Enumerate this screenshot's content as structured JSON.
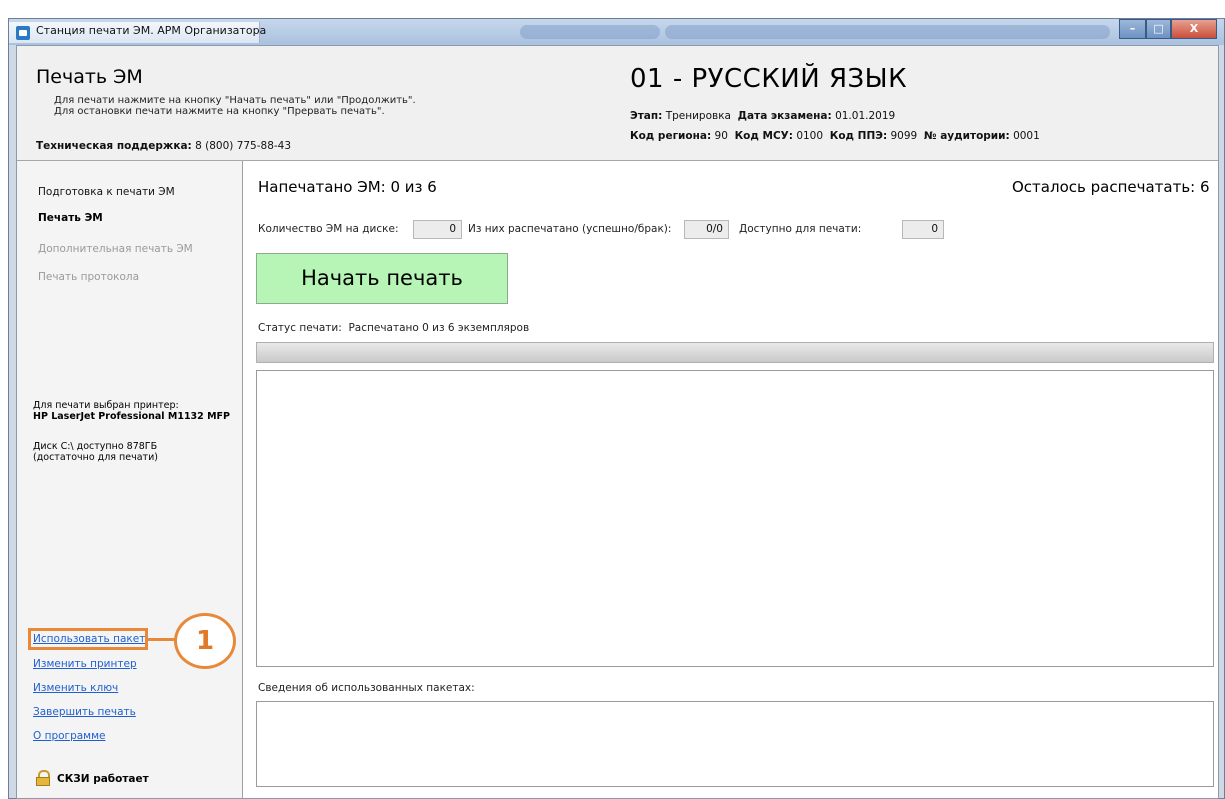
{
  "window": {
    "title": "Станция печати ЭМ. АРМ Организатора",
    "buttons": {
      "minimize": "–",
      "maximize": "□",
      "close": "X"
    }
  },
  "header": {
    "title": "Печать ЭМ",
    "hint_line1": "Для печати нажмите на кнопку \"Начать печать\" или \"Продолжить\".",
    "hint_line2": "Для остановки печати нажмите на кнопку \"Прервать печать\".",
    "support_label": "Техническая поддержка:",
    "support_phone": "8 (800) 775-88-43",
    "subject": "01 - РУССКИЙ ЯЗЫК",
    "stage_label": "Этап:",
    "stage_value": "Тренировка",
    "exam_date_label": "Дата экзамена:",
    "exam_date_value": "01.01.2019",
    "region_label": "Код региона:",
    "region_value": "90",
    "msu_label": "Код МСУ:",
    "msu_value": "0100",
    "ppe_label": "Код ППЭ:",
    "ppe_value": "9099",
    "room_label": "№ аудитории:",
    "room_value": "0001"
  },
  "sidebar": {
    "nav": [
      {
        "label": "Подготовка к печати ЭМ",
        "state": "normal"
      },
      {
        "label": "Печать ЭМ",
        "state": "active"
      },
      {
        "label": "Дополнительная печать ЭМ",
        "state": "disabled"
      },
      {
        "label": "Печать протокола",
        "state": "disabled"
      }
    ],
    "printer_caption": "Для печати выбран принтер:",
    "printer_name": "HP LaserJet Professional M1132 MFP",
    "disk_line1": "Диск C:\\ доступно 878ГБ",
    "disk_line2": "(достаточно для печати)",
    "links": [
      {
        "label": "Использовать пакет"
      },
      {
        "label": "Изменить принтер"
      },
      {
        "label": "Изменить ключ"
      },
      {
        "label": "Завершить печать"
      },
      {
        "label": "О программе"
      }
    ],
    "skzi_status": "СКЗИ работает"
  },
  "main": {
    "printed_label": "Напечатано ЭМ: 0 из 6",
    "remaining_label": "Осталось распечатать: 6",
    "disk_count_label": "Количество ЭМ на диске:",
    "disk_count_value": "0",
    "printed_of_label": "Из них распечатано (успешно/брак):",
    "printed_of_value": "0/0",
    "available_label": "Доступно для печати:",
    "available_value": "0",
    "start_button": "Начать печать",
    "status_label": "Статус печати:",
    "status_value": "Распечатано 0 из 6 экземпляров",
    "progress_fraction": 0,
    "packages_label": "Сведения об использованных пакетах:"
  },
  "callout": {
    "number": "1"
  },
  "colors": {
    "accent_orange": "#e8893a",
    "start_button_bg": "#b6f5b6",
    "link_blue": "#1f5fd1"
  }
}
